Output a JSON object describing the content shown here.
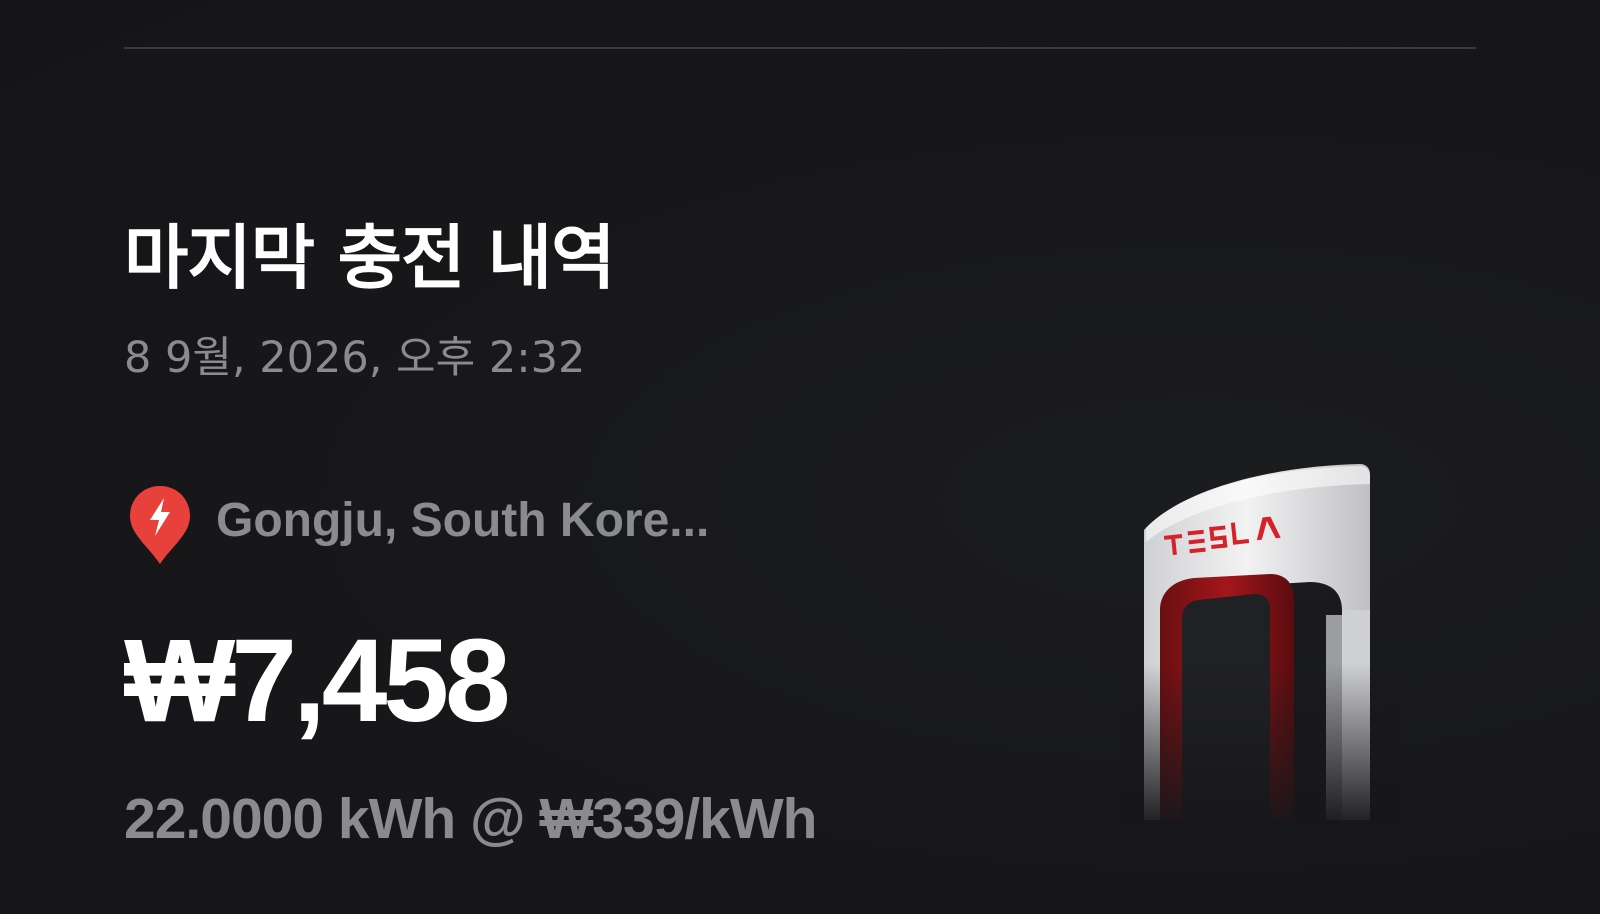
{
  "last_charge": {
    "title": "마지막 충전 내역",
    "datetime": "8 9월, 2026, 오후 2:32",
    "location": "Gongju, South Kore...",
    "amount": "₩7,458",
    "energy_summary": "22.0000 kWh @ ₩339/kWh"
  },
  "icons": {
    "location": "supercharger-pin-icon"
  },
  "charger_image": {
    "logo_text": "TESLA"
  },
  "colors": {
    "background": "#17171a",
    "primary_text": "#ffffff",
    "secondary_text": "#8a8b8f",
    "pin_red": "#e8403b",
    "divider": "#3a3b3f"
  }
}
